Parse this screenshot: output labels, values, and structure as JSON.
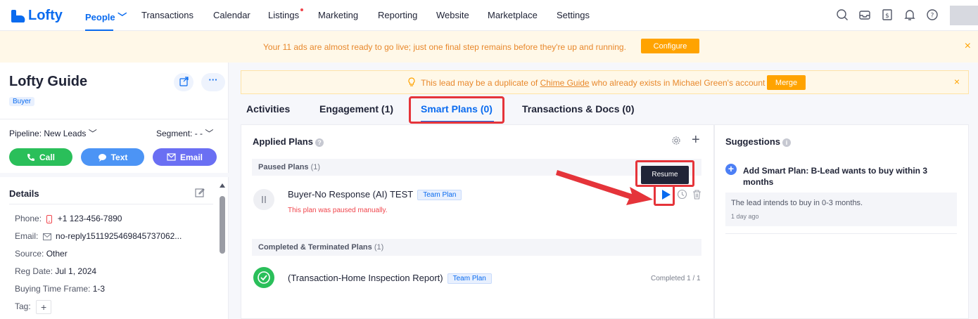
{
  "nav": {
    "logo": "Lofty",
    "items": [
      "People",
      "Transactions",
      "Calendar",
      "Listings",
      "Marketing",
      "Reporting",
      "Website",
      "Marketplace",
      "Settings"
    ],
    "active": "People"
  },
  "announcement": {
    "text": "Your 11 ads are almost ready to go live; just one final step remains before they're up and running.",
    "button": "Configure",
    "close": "×"
  },
  "lead": {
    "name": "Lofty Guide",
    "badge": "Buyer",
    "more": "···",
    "pipeline": "Pipeline: New Leads ﹀",
    "segment": "Segment: - - ﹀",
    "actions": {
      "call": "Call",
      "text": "Text",
      "email": "Email"
    },
    "details_title": "Details",
    "details": [
      {
        "label": "Phone:",
        "value": "+1 123-456-7890"
      },
      {
        "label": "Email:",
        "value": "no-reply1511925469845737062..."
      },
      {
        "label": "Source:",
        "value": "Other"
      },
      {
        "label": "Reg Date:",
        "value": "Jul 1, 2024"
      },
      {
        "label": "Buying Time Frame:",
        "value": "1-3"
      },
      {
        "label": "Tag:",
        "value": "+"
      }
    ]
  },
  "duplicate": {
    "prefix": "This lead may be a duplicate of ",
    "link": "Chime Guide",
    "suffix": " who already exists in Michael Green's account",
    "button": "Merge",
    "close": "×"
  },
  "tabs": [
    "Activities",
    "Engagement (1)",
    "Smart Plans (0)",
    "Transactions & Docs (0)"
  ],
  "plans": {
    "title": "Applied Plans",
    "info": "?",
    "paused": {
      "label": "Paused Plans",
      "count": "(1)"
    },
    "paused_plan": {
      "name": "Buyer-No Response (AI) TEST",
      "badge": "Team Plan",
      "note": "This plan was paused manually."
    },
    "tooltip": "Resume",
    "completed": {
      "label": "Completed & Terminated Plans",
      "count": "(1)"
    },
    "completed_plan": {
      "name": "(Transaction-Home Inspection Report)",
      "badge": "Team Plan",
      "status": "Completed 1 / 1"
    },
    "add": "+"
  },
  "suggestions": {
    "title": "Suggestions",
    "info": "i",
    "item_title": "Add Smart Plan: B-Lead wants to buy within 3 months",
    "item_desc": "The lead intends to buy in 0-3 months.",
    "item_time": "1 day ago",
    "add": "+"
  },
  "colors": {
    "brand": "#0a6bef",
    "highlight": "#e5343a",
    "warning": "#ffa300"
  }
}
